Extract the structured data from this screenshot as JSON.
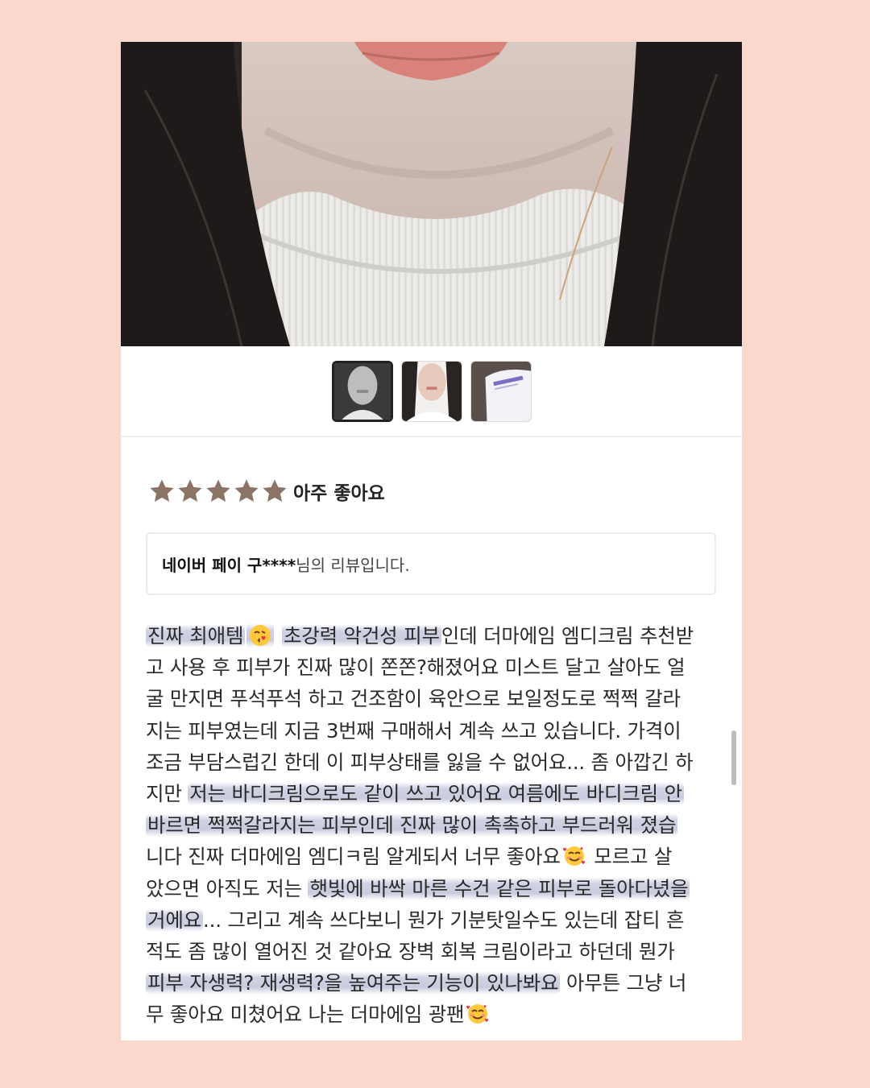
{
  "rating": {
    "stars": 5,
    "label": "아주 좋아요",
    "star_color": "#8B7466"
  },
  "reviewer": {
    "name": "네이버 페이 구****",
    "suffix": "님의 리뷰입니다."
  },
  "review_lines": [
    [
      "진짜 최애템",
      "kiss-emoji",
      " ",
      "초강력 악건성 피부",
      "인데 더마에임 엠디크림 추천받"
    ],
    [
      "고 사용 후 피부가 진짜 많이 쫀쫀?해졌어요 미스트 달고 살아도 얼"
    ],
    [
      "굴 만지면 푸석푸석 하고 건조함이 육안으로 보일정도로 쩍쩍 갈라"
    ],
    [
      "지는 피부였는데 지금 3번째 구매해서 계속 쓰고 있습니다. 가격이"
    ],
    [
      "조금 부담스럽긴 한데 이 피부상태를 잃을 수 없어요... 좀 아깝긴 하"
    ],
    [
      "지만 ",
      "저는 바디크림으로도 같이 쓰고 있어요 여름에도 바디크림 안"
    ],
    [
      "바르면 쩍쩍갈라지는 피부인데 진짜 많이 촉촉하고 부드러워 졌습"
    ],
    [
      "니다 진짜 더마에임 엠디ㅋ림 알게되서 너무 좋아요",
      "hearts-emoji",
      " 모르고 살"
    ],
    [
      "았으면 아직도 저는 ",
      "햇빛에 바싹 마른 수건 같은 피부로 돌아다녔을"
    ],
    [
      "거에요",
      "... 그리고 계속 쓰다보니 뭔가 기분탓일수도 있는데 잡티 흔"
    ],
    [
      "적도 좀 많이 열어진 것 같아요 장벽 회복 크림이라고 하던데 뭔가"
    ],
    [
      "피부 자생력? 재생력?을 높여주는 기능이 있나봐요",
      " 아무튼 그냥 너"
    ],
    [
      "무 좋아요 미쳤어요 나는 더마에임 광팬",
      "hearts-emoji"
    ]
  ],
  "colors": {
    "page_background": "#FBD8CC",
    "card": "#FFFFFF",
    "highlight": "#AAAFCD"
  }
}
